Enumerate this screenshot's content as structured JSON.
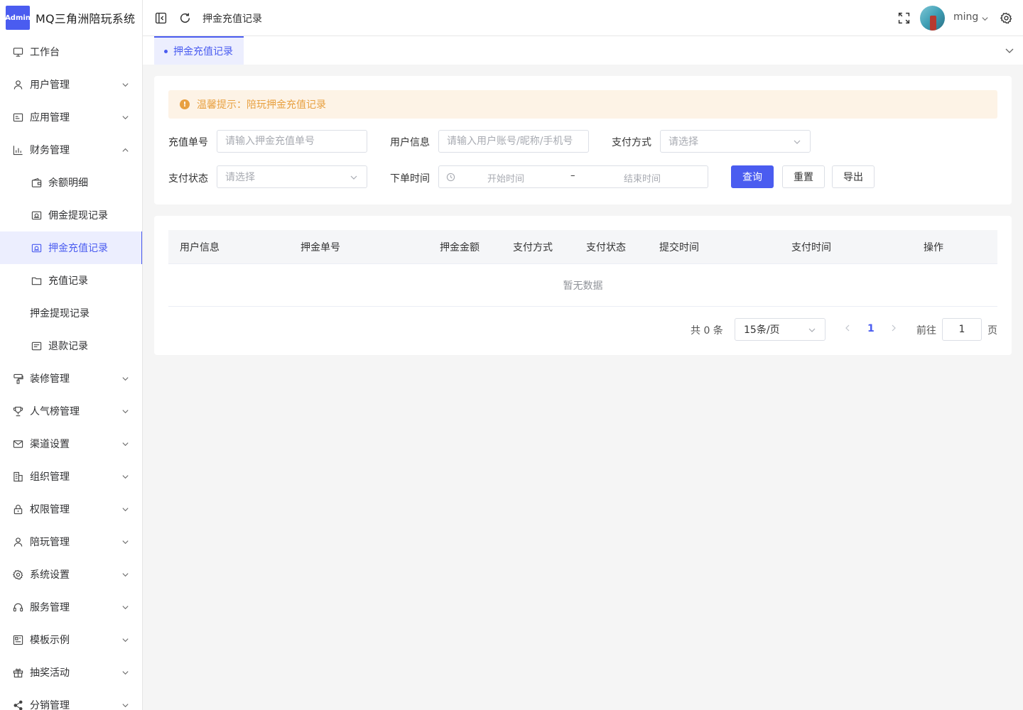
{
  "brand": {
    "logo_text": "Admin",
    "title": "MQ三角洲陪玩系统"
  },
  "sidebar": {
    "items": [
      {
        "label": "工作台",
        "icon": "monitor-icon",
        "expandable": false
      },
      {
        "label": "用户管理",
        "icon": "user-icon",
        "expandable": true
      },
      {
        "label": "应用管理",
        "icon": "app-icon",
        "expandable": true
      },
      {
        "label": "财务管理",
        "icon": "chart-icon",
        "expandable": true,
        "expanded": true
      },
      {
        "label": "余额明细",
        "icon": "wallet-icon",
        "sub": true
      },
      {
        "label": "佣金提现记录",
        "icon": "money-icon",
        "sub": true
      },
      {
        "label": "押金充值记录",
        "icon": "money-icon",
        "sub": true,
        "active": true
      },
      {
        "label": "充值记录",
        "icon": "folder-icon",
        "sub": true
      },
      {
        "label": "押金提现记录",
        "icon": "",
        "sub": true
      },
      {
        "label": "退款记录",
        "icon": "list-icon",
        "sub": true
      },
      {
        "label": "装修管理",
        "icon": "brush-icon",
        "expandable": true
      },
      {
        "label": "人气榜管理",
        "icon": "trophy-icon",
        "expandable": true
      },
      {
        "label": "渠道设置",
        "icon": "mail-icon",
        "expandable": true
      },
      {
        "label": "组织管理",
        "icon": "building-icon",
        "expandable": true
      },
      {
        "label": "权限管理",
        "icon": "lock-icon",
        "expandable": true
      },
      {
        "label": "陪玩管理",
        "icon": "user-icon",
        "expandable": true
      },
      {
        "label": "系统设置",
        "icon": "gear-icon",
        "expandable": true
      },
      {
        "label": "服务管理",
        "icon": "headset-icon",
        "expandable": true
      },
      {
        "label": "模板示例",
        "icon": "template-icon",
        "expandable": true
      },
      {
        "label": "抽奖活动",
        "icon": "gift-icon",
        "expandable": true
      },
      {
        "label": "分销管理",
        "icon": "share-icon",
        "expandable": true
      }
    ]
  },
  "header": {
    "breadcrumb": "押金充值记录",
    "username": "ming"
  },
  "tags": {
    "active_label": "押金充值记录"
  },
  "alert": {
    "text": "温馨提示：陪玩押金充值记录"
  },
  "filters": {
    "order_no_label": "充值单号",
    "order_no_placeholder": "请输入押金充值单号",
    "user_label": "用户信息",
    "user_placeholder": "请输入用户账号/昵称/手机号",
    "pay_method_label": "支付方式",
    "pay_method_placeholder": "请选择",
    "pay_status_label": "支付状态",
    "pay_status_placeholder": "请选择",
    "time_label": "下单时间",
    "start_placeholder": "开始时间",
    "range_separator": "–",
    "end_placeholder": "结束时间",
    "query_label": "查询",
    "reset_label": "重置",
    "export_label": "导出"
  },
  "table": {
    "columns": [
      "用户信息",
      "押金单号",
      "押金金额",
      "支付方式",
      "支付状态",
      "提交时间",
      "支付时间",
      "操作"
    ],
    "empty_text": "暂无数据"
  },
  "pagination": {
    "total_text": "共 0 条",
    "page_size": "15条/页",
    "current_page": "1",
    "goto_label": "前往",
    "goto_value": "1",
    "page_suffix": "页"
  },
  "colors": {
    "primary": "#4a5cf0",
    "warning": "#e8a040",
    "warning_bg": "#fdf3e6"
  }
}
